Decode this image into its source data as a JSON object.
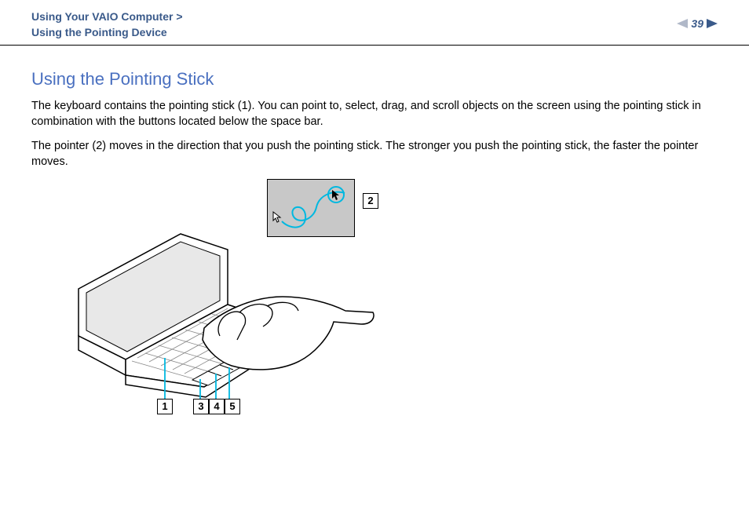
{
  "header": {
    "breadcrumb_line1": "Using Your VAIO Computer >",
    "breadcrumb_line2": "Using the Pointing Device",
    "page_number": "39"
  },
  "content": {
    "heading": "Using the Pointing Stick",
    "para1": "The keyboard contains the pointing stick (1). You can point to, select, drag, and scroll objects on the screen using the pointing stick in combination with the buttons located below the space bar.",
    "para2": "The pointer (2) moves in the direction that you push the pointing stick. The stronger you push the pointing stick, the faster the pointer moves."
  },
  "callouts": {
    "c1": "1",
    "c2": "2",
    "c3": "3",
    "c4": "4",
    "c5": "5"
  }
}
